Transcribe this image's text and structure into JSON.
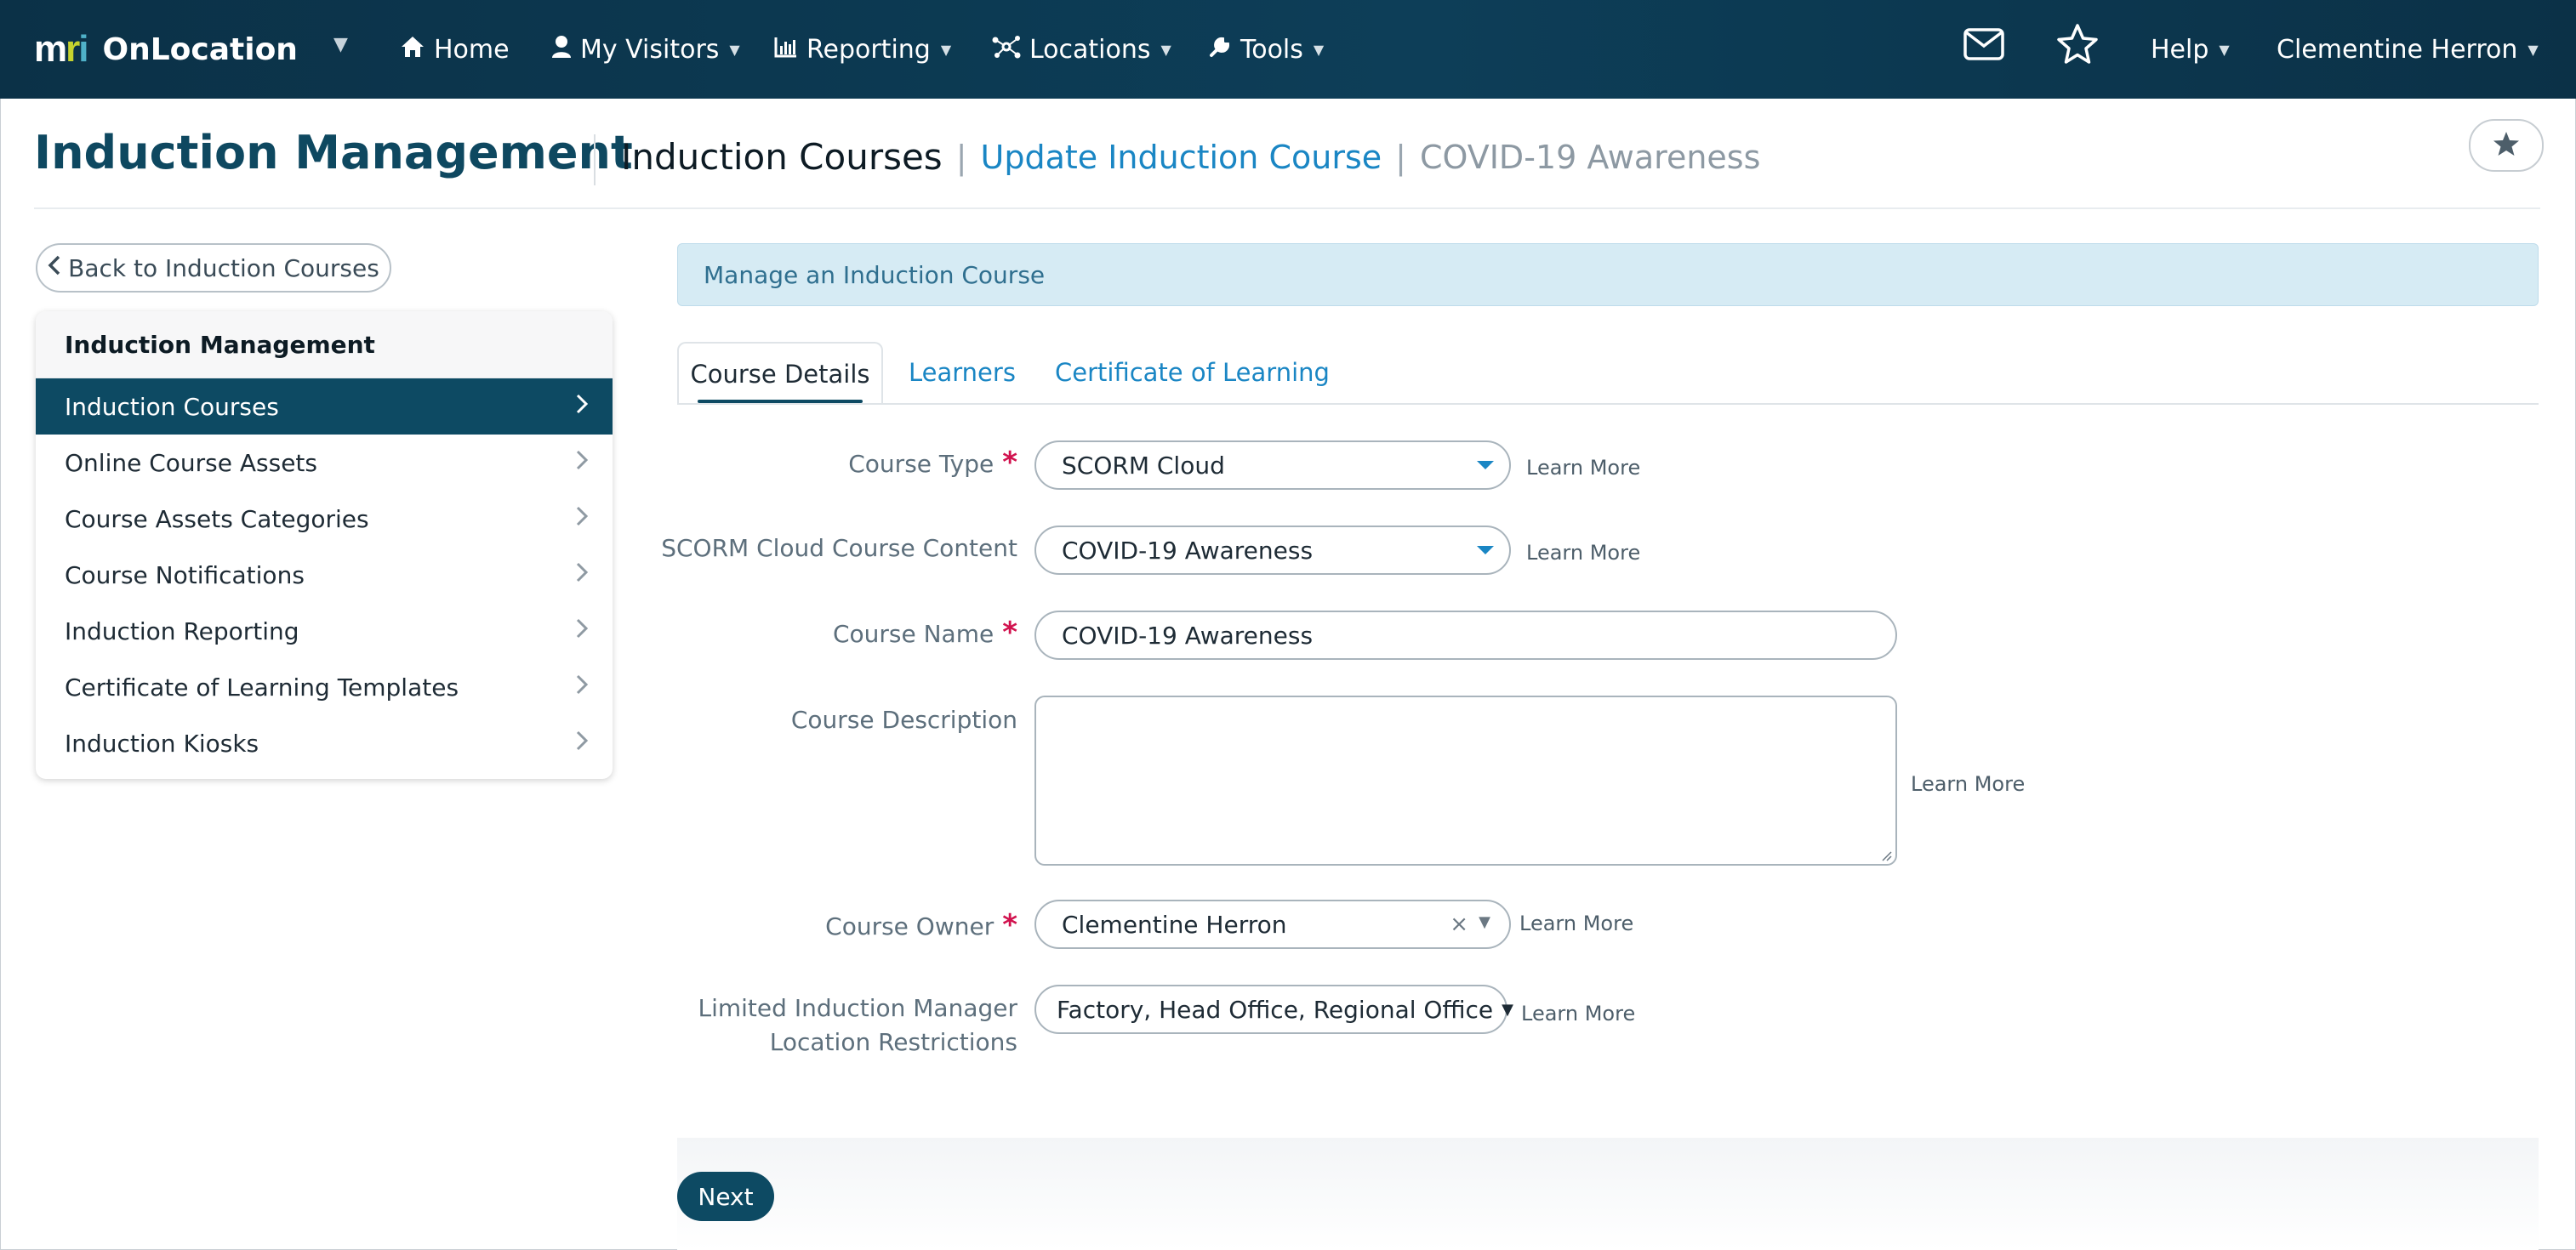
{
  "brand": {
    "logo_text": "mri",
    "app_name": "OnLocation"
  },
  "nav": {
    "home": "Home",
    "my_visitors": "My Visitors",
    "reporting": "Reporting",
    "locations": "Locations",
    "tools": "Tools",
    "help": "Help",
    "user": "Clementine Herron"
  },
  "header": {
    "title": "Induction Management",
    "crumb_section": "Induction Courses",
    "crumb_action": "Update Induction Course",
    "crumb_item": "COVID-19 Awareness"
  },
  "sidebar": {
    "back_label": "Back to Induction Courses",
    "heading": "Induction Management",
    "items": [
      {
        "label": "Induction Courses",
        "active": true
      },
      {
        "label": "Online Course Assets",
        "active": false
      },
      {
        "label": "Course Assets Categories",
        "active": false
      },
      {
        "label": "Course Notifications",
        "active": false
      },
      {
        "label": "Induction Reporting",
        "active": false
      },
      {
        "label": "Certificate of Learning Templates",
        "active": false
      },
      {
        "label": "Induction Kiosks",
        "active": false
      }
    ]
  },
  "main": {
    "banner": "Manage an Induction Course",
    "tabs": [
      "Course Details",
      "Learners",
      "Certificate of Learning"
    ],
    "learn_more": "Learn More",
    "form": {
      "course_type": {
        "label": "Course Type",
        "value": "SCORM Cloud"
      },
      "scorm_content": {
        "label": "SCORM Cloud Course Content",
        "value": "COVID-19 Awareness"
      },
      "course_name": {
        "label": "Course Name",
        "value": "COVID-19 Awareness"
      },
      "course_description": {
        "label": "Course Description",
        "value": ""
      },
      "course_owner": {
        "label": "Course Owner",
        "value": "Clementine Herron"
      },
      "location_restrictions": {
        "label_line1": "Limited Induction Manager",
        "label_line2": "Location Restrictions",
        "value": "Factory, Head Office, Regional Office"
      },
      "required_mark": "*"
    },
    "next_label": "Next"
  },
  "colors": {
    "nav_bg": "#0b3147",
    "brand_primary": "#0d4a63",
    "link": "#1a86c4",
    "required": "#d1124e",
    "banner_bg": "#d6ebf4"
  },
  "icons": {
    "home": "home-icon",
    "visitors": "user-icon",
    "reporting": "bar-chart-icon",
    "locations": "network-icon",
    "tools": "wrench-icon",
    "mail": "envelope-icon",
    "favorites": "star-outline-icon",
    "bookmark": "star-filled-icon"
  }
}
